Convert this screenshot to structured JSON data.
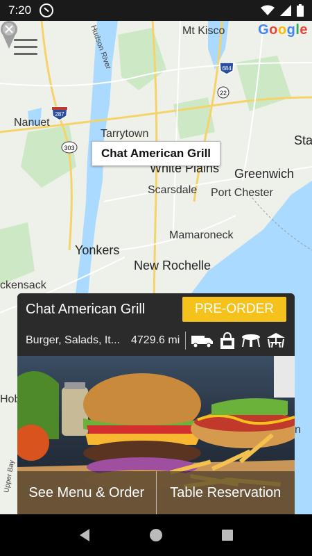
{
  "status_bar": {
    "time": "7:20",
    "icons": [
      "app-notification-icon",
      "wifi-icon",
      "cellular-signal-icon",
      "battery-icon"
    ]
  },
  "map": {
    "provider_logo": "Google",
    "labels": {
      "mt_kisco": "Mt Kisco",
      "hudson_river": "Hudson River",
      "nanuet": "Nanuet",
      "tarrytown": "Tarrytown",
      "white_plains": "White Plains",
      "scarsdale": "Scarsdale",
      "greenwich": "Greenwich",
      "port_chester": "Port Chester",
      "stamford": "Star",
      "yonkers": "Yonkers",
      "mamaroneck": "Mamaroneck",
      "new_rochelle": "New Rochelle",
      "hackensack": "ckensack",
      "hoboken": "Hob",
      "upper_bay": "Upper Bay",
      "n_edge": "n"
    },
    "route_shields": [
      "684",
      "22",
      "287",
      "303"
    ],
    "marker_callout": "Chat American Grill"
  },
  "restaurant_card": {
    "name": "Chat American Grill",
    "preorder_label": "PRE-ORDER",
    "cuisine": "Burger, Salads, It...",
    "distance": "4729.6 mi",
    "service_icons": [
      "delivery-truck-icon",
      "takeout-bag-icon",
      "dine-in-table-icon",
      "outdoor-seating-icon"
    ],
    "see_menu_label": "See Menu & Order",
    "table_reservation_label": "Table Reservation"
  },
  "colors": {
    "accent": "#f5c21b",
    "card_bg": "#2b2b2b",
    "water": "#aadaff",
    "park": "#cde8c4"
  }
}
